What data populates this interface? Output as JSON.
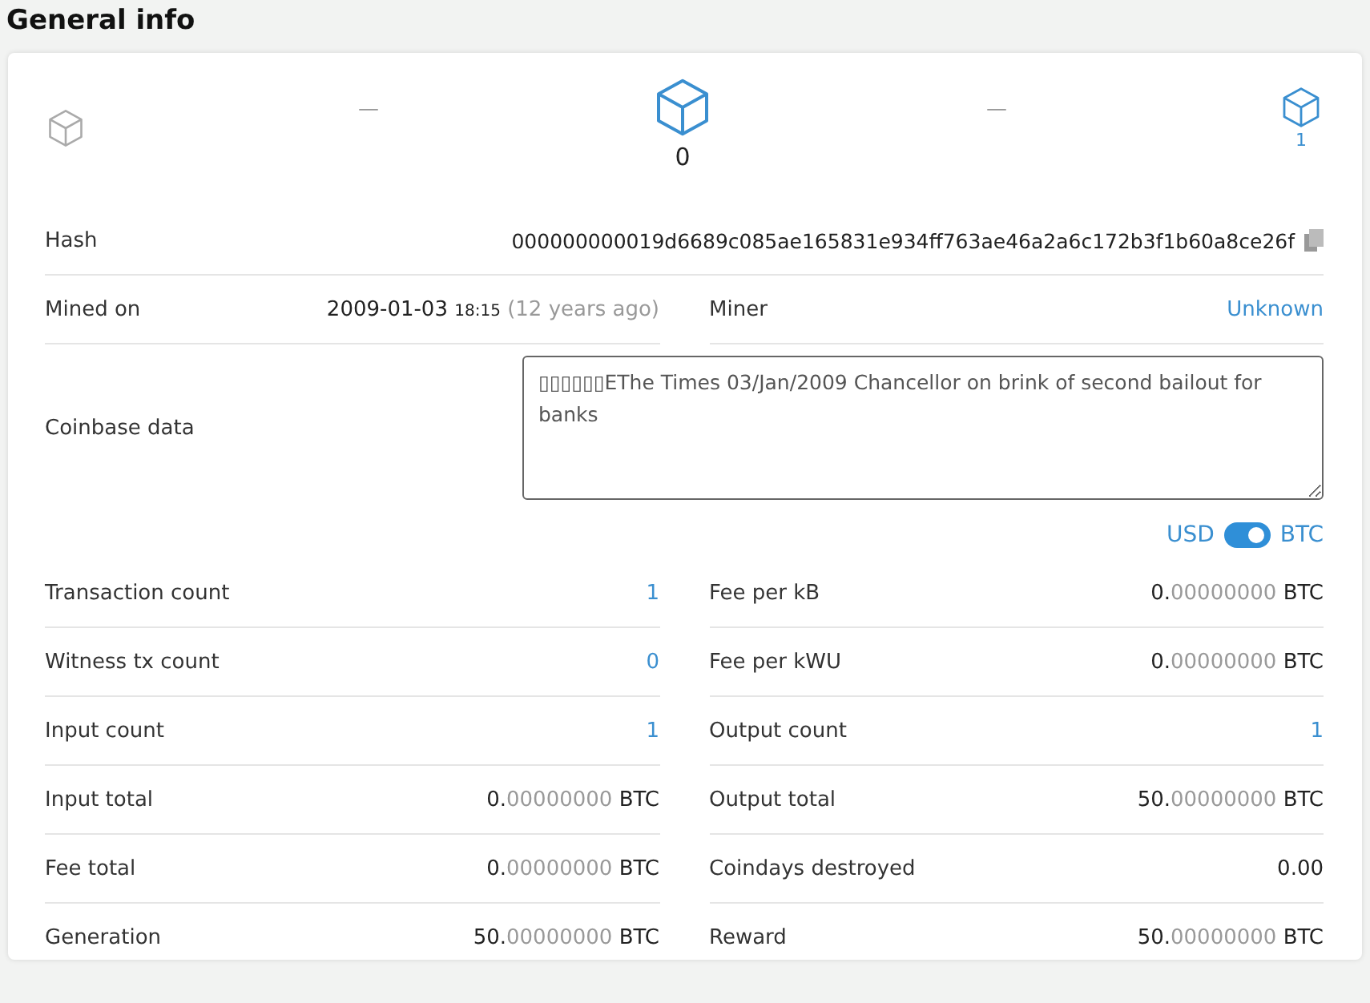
{
  "title": "General info",
  "block_nav": {
    "prev": {
      "label": "—",
      "disabled": true
    },
    "current": {
      "label": "0"
    },
    "next_dash": "—",
    "next": {
      "label": "1",
      "disabled": false
    }
  },
  "hash": {
    "label": "Hash",
    "value": "000000000019d6689c085ae165831e934ff763ae46a2a6c172b3f1b60a8ce26f"
  },
  "mined_on": {
    "label": "Mined on",
    "date": "2009-01-03",
    "time": "18:15",
    "ago": "(12 years ago)"
  },
  "miner": {
    "label": "Miner",
    "value": "Unknown"
  },
  "coinbase": {
    "label": "Coinbase data",
    "value": "▯▯▯▯▯▯EThe Times 03/Jan/2009 Chancellor on brink of second bailout for banks"
  },
  "currency_toggle": {
    "left": "USD",
    "right": "BTC",
    "on": true
  },
  "rows": [
    {
      "kind": "link",
      "label": "Transaction count",
      "value": "1"
    },
    {
      "kind": "amount",
      "label": "Fee per kB",
      "whole": "0.",
      "fraction": "00000000",
      "unit": "BTC"
    },
    {
      "kind": "link",
      "label": "Witness tx count",
      "value": "0"
    },
    {
      "kind": "amount",
      "label": "Fee per kWU",
      "whole": "0.",
      "fraction": "00000000",
      "unit": "BTC"
    },
    {
      "kind": "link",
      "label": "Input count",
      "value": "1"
    },
    {
      "kind": "link",
      "label": "Output count",
      "value": "1"
    },
    {
      "kind": "amount",
      "label": "Input total",
      "whole": "0.",
      "fraction": "00000000",
      "unit": "BTC"
    },
    {
      "kind": "amount",
      "label": "Output total",
      "whole": "50.",
      "fraction": "00000000",
      "unit": "BTC"
    },
    {
      "kind": "amount",
      "label": "Fee total",
      "whole": "0.",
      "fraction": "00000000",
      "unit": "BTC"
    },
    {
      "kind": "plain",
      "label": "Coindays destroyed",
      "value": "0.00"
    },
    {
      "kind": "amount",
      "label": "Generation",
      "whole": "50.",
      "fraction": "00000000",
      "unit": "BTC"
    },
    {
      "kind": "amount",
      "label": "Reward",
      "whole": "50.",
      "fraction": "00000000",
      "unit": "BTC"
    }
  ]
}
